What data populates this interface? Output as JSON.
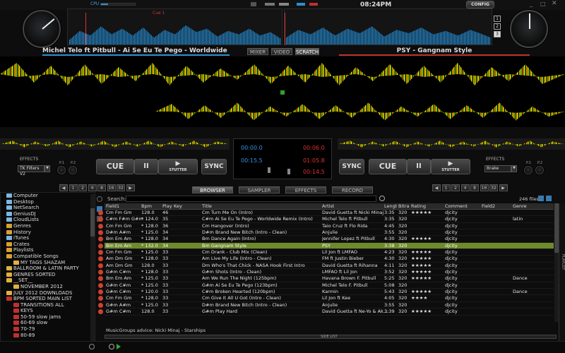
{
  "app": {
    "time": "08:24PM",
    "config_label": "CONFIG",
    "cpu_label": "CPU"
  },
  "deck_left": {
    "title": "Michel Telo ft Pitbull - Ai Se Eu Te Pego - Worldwide Remi...",
    "cue_marker": "Cue 1",
    "elapsed": "00:00.0",
    "remain": "00:15.5",
    "effects_label": "EFFECTS",
    "effect_select": "TK Filters V2",
    "cue": "CUE",
    "play_pause": "II",
    "play": "▶",
    "stutter": "STUTTER",
    "sync": "SYNC",
    "p1": "P.1",
    "p2": "P.2"
  },
  "deck_right": {
    "title": "PSY - Gangnam Style",
    "elapsed": "00:06.0",
    "remain": "01:05.8",
    "remain2": "00:14.5",
    "effects_label": "EFFECTS",
    "effect_select": "Brake",
    "cue": "CUE",
    "play_pause": "II",
    "play": "▶",
    "stutter": "STUTTER",
    "sync": "SYNC",
    "p1": "P.1",
    "p2": "P.2",
    "deck_nums": [
      "1",
      "2",
      "3"
    ]
  },
  "center_tabs": [
    "MIXER",
    "VIDEO",
    "SCRATCH"
  ],
  "loop_buttons": [
    "◀",
    "1",
    "2",
    "4",
    "8",
    "16",
    "32",
    "▶"
  ],
  "browser_tabs": [
    "BROWSER",
    "SAMPLER",
    "EFFECTS",
    "RECORD"
  ],
  "search": {
    "label": "Search:",
    "value": "",
    "files": "246 files"
  },
  "tree": [
    {
      "label": "Computer",
      "indent": 0,
      "color": "#7bb7e0"
    },
    {
      "label": "Desktop",
      "indent": 0,
      "color": "#7bb7e0"
    },
    {
      "label": "NetSearch",
      "indent": 0,
      "color": "#7bb7e0"
    },
    {
      "label": "GeniusDJ",
      "indent": 0,
      "color": "#7bb7e0"
    },
    {
      "label": "CloudLists",
      "indent": 0,
      "color": "#7bb7e0"
    },
    {
      "label": "Genres",
      "indent": 0,
      "color": "#d8a030"
    },
    {
      "label": "History",
      "indent": 0,
      "color": "#d8a030"
    },
    {
      "label": "iTunes",
      "indent": 0,
      "color": "#7bb7e0"
    },
    {
      "label": "Crates",
      "indent": 0,
      "color": "#d8a030"
    },
    {
      "label": "Playlists",
      "indent": 0,
      "color": "#d8a030"
    },
    {
      "label": "Compatible Songs",
      "indent": 0,
      "color": "#d8a030"
    },
    {
      "label": "MY TAGS SHAZAM",
      "indent": 1,
      "color": "#e0b040"
    },
    {
      "label": "BALLROOM & LATIN PARTY",
      "indent": 0,
      "color": "#e0b040"
    },
    {
      "label": "GENRES SORTED",
      "indent": 0,
      "color": "#e0b040"
    },
    {
      "label": "__SET__",
      "indent": 0,
      "color": "#e0b040"
    },
    {
      "label": "NOVEMBER 2012",
      "indent": 1,
      "color": "#e0b040"
    },
    {
      "label": "JULY 2012 DOWNLOADS",
      "indent": 0,
      "color": "#e0b040"
    },
    {
      "label": "BPM SORTED MAIN LIST",
      "indent": 0,
      "color": "#c03030"
    },
    {
      "label": "TRANSITIONS ALL",
      "indent": 1,
      "color": "#c03030"
    },
    {
      "label": "KEYS",
      "indent": 1,
      "color": "#c03030"
    },
    {
      "label": "50-59 slow jams",
      "indent": 1,
      "color": "#c03030"
    },
    {
      "label": "60-69 slow",
      "indent": 1,
      "color": "#c03030"
    },
    {
      "label": "70-79",
      "indent": 1,
      "color": "#c03030"
    },
    {
      "label": "80-89",
      "indent": 1,
      "color": "#c03030"
    }
  ],
  "columns": [
    "Field1",
    "Bpm",
    "Play",
    "Key",
    "Title",
    "Artist",
    "Lengt",
    "Bitra",
    "Rating",
    "Comment",
    "Field2",
    "Genre"
  ],
  "rows": [
    {
      "field1": "Cm Fm Gm",
      "bpm": "128.0",
      "play": "46",
      "key": "",
      "title": "Cm Turn Me On (Intro)",
      "artist": "David Guetta ft Nicki Minaj",
      "len": "3:35",
      "bit": "320",
      "rating": "★★★★★",
      "comment": "djcity",
      "field2": "",
      "genre": ""
    },
    {
      "field1": "C#m F#m G#m",
      "bpm": "* 124.0",
      "play": "35",
      "key": "",
      "title": "C#m Ai Se Eu Te Pego - Worldwide Remix (Intro)",
      "artist": "Michel Telo ft Pitbull",
      "len": "3:35",
      "bit": "320",
      "rating": "",
      "comment": "djcity",
      "field2": "",
      "genre": "latin"
    },
    {
      "field1": "Cm Fm Gm",
      "bpm": "* 128.0",
      "play": "36",
      "key": "",
      "title": "Cm Hangover (Intro)",
      "artist": "Taio Cruz ft Flo Rida",
      "len": "4:45",
      "bit": "320",
      "rating": "",
      "comment": "djcity",
      "field2": "",
      "genre": ""
    },
    {
      "field1": "D#m A#m",
      "bpm": "* 125.0",
      "play": "34",
      "key": "",
      "title": "D#m Brand New Bitch (Intro - Clean)",
      "artist": "Anjulie",
      "len": "3:55",
      "bit": "320",
      "rating": "",
      "comment": "djcity",
      "field2": "",
      "genre": ""
    },
    {
      "field1": "Bm Em Am",
      "bpm": "* 128.0",
      "play": "34",
      "key": "",
      "title": "Bm Dance Again (Intro)",
      "artist": "Jennifer Lopez ft Pitbull",
      "len": "4:30",
      "bit": "320",
      "rating": "★★★★★",
      "comment": "djcity",
      "field2": "",
      "genre": ""
    },
    {
      "field1": "Bm Em Am",
      "bpm": "* 132.0",
      "play": "34",
      "key": "",
      "title": "Bm Gangnam Style",
      "artist": "PSY",
      "len": "3:38",
      "bit": "320",
      "rating": "",
      "comment": "djcity",
      "field2": "",
      "genre": "",
      "selected": true
    },
    {
      "field1": "Cm Fm Gm",
      "bpm": "* 125.0",
      "play": "33",
      "key": "",
      "title": "Cm Drank - Club Mix (Clean)",
      "artist": "Lil Jon ft LMFAO",
      "len": "4:23",
      "bit": "320",
      "rating": "★★★★★",
      "comment": "djcity",
      "field2": "",
      "genre": ""
    },
    {
      "field1": "Am Dm Gm",
      "bpm": "* 128.0",
      "play": "33",
      "key": "",
      "title": "Am Live My Life (Intro - Clean)",
      "artist": "FM ft Justin Bieber",
      "len": "4:30",
      "bit": "320",
      "rating": "★★★★★",
      "comment": "djcity",
      "field2": "",
      "genre": ""
    },
    {
      "field1": "Am Dm Gm",
      "bpm": "128.0",
      "play": "33",
      "key": "",
      "title": "Dm Who's That Chick - NASA Hook First Intro",
      "artist": "David Guetta ft Rihanna",
      "len": "4:11",
      "bit": "320",
      "rating": "★★★★★",
      "comment": "djcity",
      "field2": "",
      "genre": ""
    },
    {
      "field1": "G#m C#m",
      "bpm": "* 128.0",
      "play": "33",
      "key": "",
      "title": "G#m Shots (Intro - Clean)",
      "artist": "LMFAO ft Lil Jon",
      "len": "3:52",
      "bit": "320",
      "rating": "★★★★★",
      "comment": "djcity",
      "field2": "",
      "genre": ""
    },
    {
      "field1": "Bm Em Am",
      "bpm": "* 125.0",
      "play": "33",
      "key": "",
      "title": "Am We Run The Night (125bpm)",
      "artist": "Havana Brown F. Pitbull",
      "len": "5:25",
      "bit": "320",
      "rating": "★★★★★",
      "comment": "djcity",
      "field2": "",
      "genre": "Dance"
    },
    {
      "field1": "G#m C#m",
      "bpm": "* 125.0",
      "play": "33",
      "key": "",
      "title": "G#m Ai Se Eu Te Pego (123bpm)",
      "artist": "Michel Telo F. Pitbull",
      "len": "5:08",
      "bit": "320",
      "rating": "",
      "comment": "djcity",
      "field2": "",
      "genre": ""
    },
    {
      "field1": "G#m C#m",
      "bpm": "* 120.0",
      "play": "33",
      "key": "",
      "title": "C#m Broken Hearted (120bpm)",
      "artist": "Karmin",
      "len": "5:43",
      "bit": "320",
      "rating": "★★★★★",
      "comment": "djcity",
      "field2": "",
      "genre": "Dance"
    },
    {
      "field1": "Cm Fm Gm",
      "bpm": "* 128.0",
      "play": "33",
      "key": "",
      "title": "Cm Give It All U Got (Intro - Clean)",
      "artist": "Lil Jon ft Kee",
      "len": "4:05",
      "bit": "320",
      "rating": "★★★★",
      "comment": "djcity",
      "field2": "",
      "genre": ""
    },
    {
      "field1": "G#m A#m",
      "bpm": "* 125.0",
      "play": "33",
      "key": "",
      "title": "D#m Brand New Bitch (Intro - Clean)",
      "artist": "Anjulie",
      "len": "3:55",
      "bit": "320",
      "rating": "",
      "comment": "djcity",
      "field2": "",
      "genre": ""
    },
    {
      "field1": "G#m C#m",
      "bpm": "128.0",
      "play": "33",
      "key": "",
      "title": "G#m Play Hard",
      "artist": "David Guetta ft Ne-Yo & Ak...",
      "len": "3:39",
      "bit": "320",
      "rating": "★★★★★",
      "comment": "djcity",
      "field2": "",
      "genre": ""
    }
  ],
  "advice": "MusicGroups advice: Nicki Minaj - Starships",
  "side_list": "SIDE LIST",
  "playlist_tab": "PLAYLIST",
  "colors": {
    "accent": "#2f8fd0",
    "selected_row": "#6e8a2a",
    "elapsed_blue": "#3a90e0",
    "elapsed_red": "#e03030"
  }
}
